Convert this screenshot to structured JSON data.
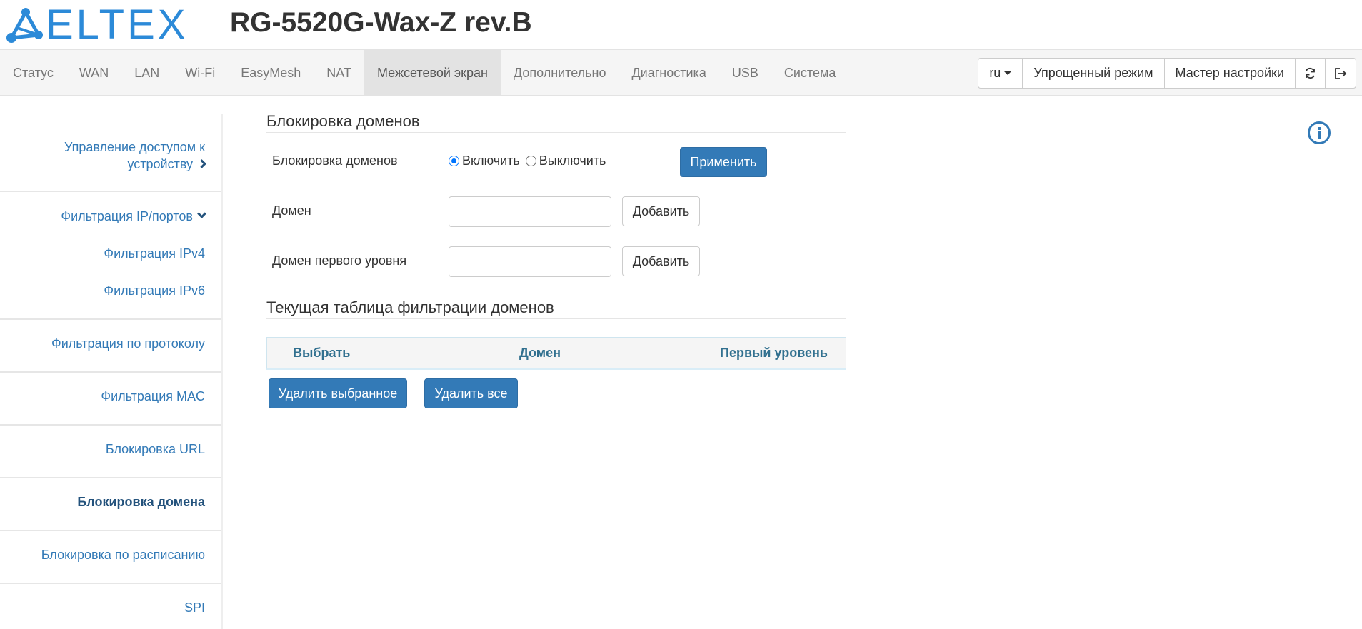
{
  "header": {
    "logo_text": "ELTEX",
    "model": "RG-5520G-Wax-Z rev.B"
  },
  "nav": {
    "items": [
      {
        "label": "Статус"
      },
      {
        "label": "WAN"
      },
      {
        "label": "LAN"
      },
      {
        "label": "Wi-Fi"
      },
      {
        "label": "EasyMesh"
      },
      {
        "label": "NAT"
      },
      {
        "label": "Межсетевой экран",
        "active": true
      },
      {
        "label": "Дополнительно"
      },
      {
        "label": "Диагностика"
      },
      {
        "label": "USB"
      },
      {
        "label": "Система"
      }
    ],
    "lang": "ru",
    "simple_mode": "Упрощенный режим",
    "wizard": "Мастер настройки"
  },
  "sidebar": {
    "access_line1": "Управление доступом к",
    "access_line2": "устройству",
    "ip_port_filter": "Фильтрация IP/портов",
    "ipv4": "Фильтрация IPv4",
    "ipv6": "Фильтрация IPv6",
    "protocol": "Фильтрация по протоколу",
    "mac": "Фильтрация MAC",
    "url": "Блокировка URL",
    "domain": "Блокировка домена",
    "schedule": "Блокировка по расписанию",
    "spi": "SPI"
  },
  "main": {
    "section_title": "Блокировка доменов",
    "blocking_label": "Блокировка доменов",
    "enable_label": "Включить",
    "disable_label": "Выключить",
    "enabled": true,
    "apply_button": "Применить",
    "domain_label": "Домен",
    "domain_value": "",
    "add_button": "Добавить",
    "tld_label": "Домен первого уровня",
    "tld_value": "",
    "add_button_2": "Добавить",
    "table_title": "Текущая таблица фильтрации доменов",
    "table_headers": {
      "select": "Выбрать",
      "domain": "Домен",
      "tld": "Первый уровень"
    },
    "delete_selected": "Удалить выбранное",
    "delete_all": "Удалить все"
  },
  "colors": {
    "brand": "#2c8ad8",
    "link": "#337ab7",
    "primary_button": "#337ab7"
  }
}
